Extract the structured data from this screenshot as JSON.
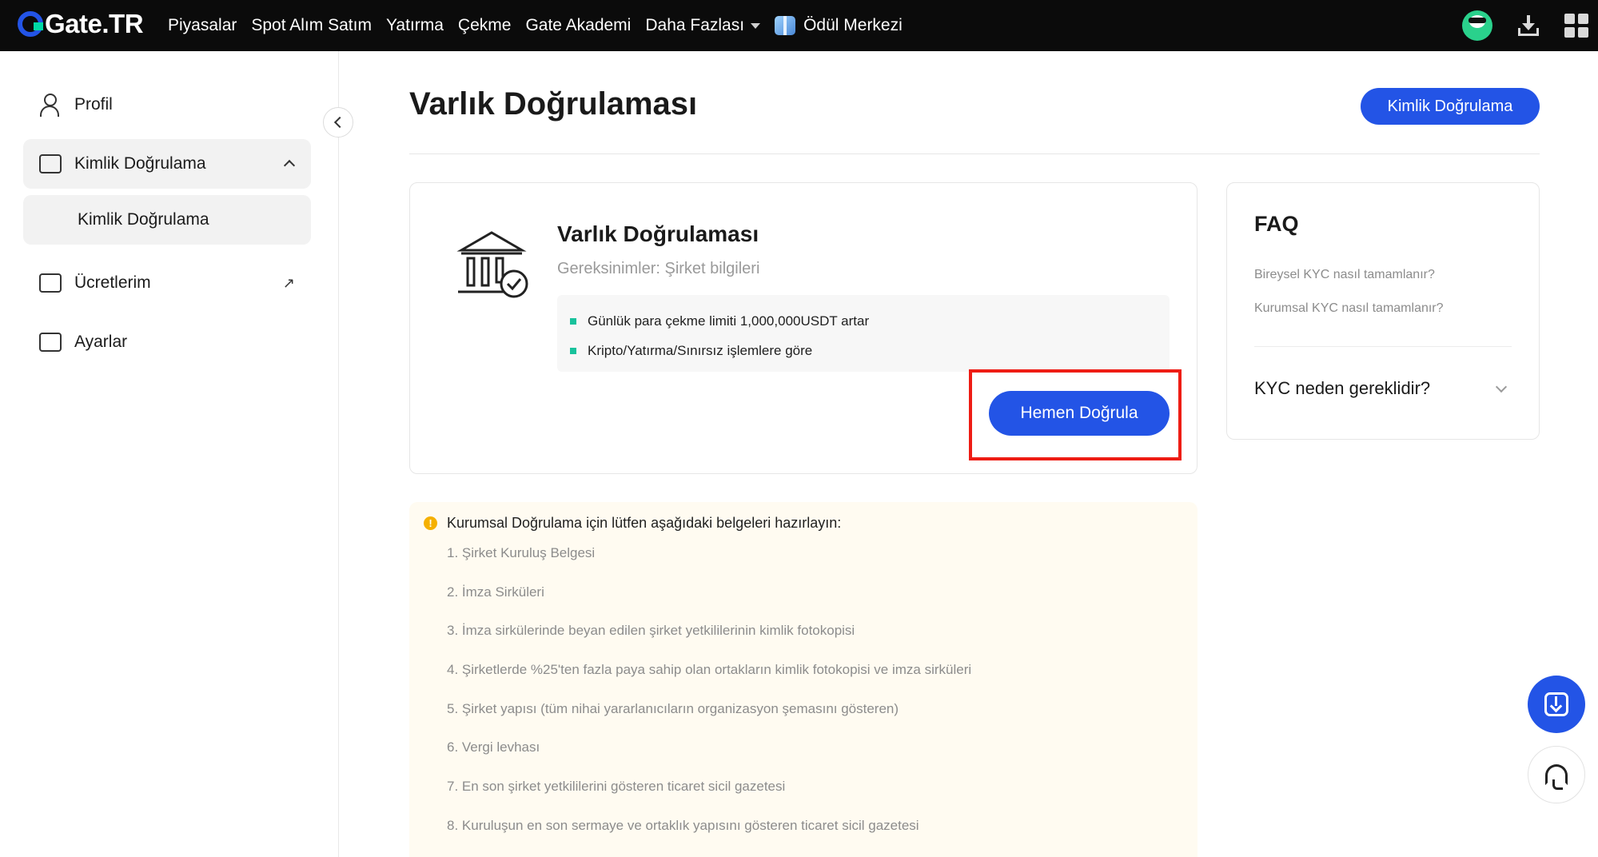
{
  "topbar": {
    "logo_text": "Gate.TR",
    "nav": [
      "Piyasalar",
      "Spot Alım Satım",
      "Yatırma",
      "Çekme",
      "Gate Akademi"
    ],
    "more_label": "Daha Fazlası",
    "rewards_label": "Ödül Merkezi"
  },
  "sidebar": {
    "profile": "Profil",
    "identity": "Kimlik Doğrulama",
    "identity_sub": "Kimlik Doğrulama",
    "fees": "Ücretlerim",
    "settings": "Ayarlar"
  },
  "main": {
    "title": "Varlık Doğrulaması",
    "header_button": "Kimlik Doğrulama",
    "card": {
      "title": "Varlık Doğrulaması",
      "req_label": "Gereksinimler:",
      "req_value": " Şirket bilgileri",
      "benefits": [
        "Günlük para çekme limiti 1,000,000USDT artar",
        "Kripto/Yatırma/Sınırsız işlemlere göre"
      ],
      "verify_button": "Hemen Doğrula"
    },
    "notice": {
      "heading": "Kurumsal Doğrulama için lütfen aşağıdaki belgeleri hazırlayın:",
      "items": [
        "1. Şirket Kuruluş Belgesi",
        "2. İmza Sirküleri",
        "3. İmza sirkülerinde beyan edilen şirket yetkililerinin kimlik fotokopisi",
        "4. Şirketlerde %25'ten fazla paya sahip olan ortakların kimlik fotokopisi ve imza sirküleri",
        "5. Şirket yapısı (tüm nihai yararlanıcıların organizasyon şemasını gösteren)",
        "6. Vergi levhası",
        "7. En son şirket yetkililerini gösteren ticaret sicil gazetesi",
        "8. Kuruluşun en son sermaye ve ortaklık yapısını gösteren ticaret sicil gazetesi"
      ]
    }
  },
  "faq": {
    "title": "FAQ",
    "links": [
      "Bireysel KYC nasıl tamamlanır?",
      "Kurumsal KYC nasıl tamamlanır?"
    ],
    "question": "KYC neden gereklidir?"
  },
  "colors": {
    "accent": "#2354e6",
    "highlight": "#ee1c14",
    "bullet": "#18c29c",
    "warning": "#f5b000"
  }
}
